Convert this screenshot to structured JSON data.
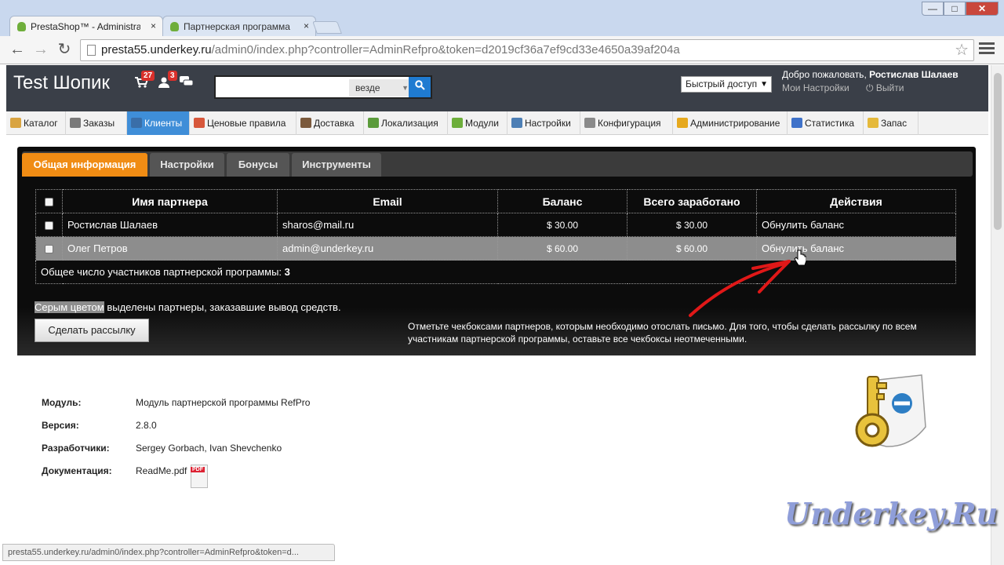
{
  "browser": {
    "tabs": [
      {
        "title": "PrestaShop™ - Administra",
        "close": "×"
      },
      {
        "title": "Партнерская программа",
        "close": "×"
      }
    ],
    "url_host": "presta55.underkey.ru",
    "url_path": "/admin0/index.php?controller=AdminRefpro&token=d2019cf36a7ef9cd33e4650a39af204a",
    "status_url": "presta55.underkey.ru/admin0/index.php?controller=AdminRefpro&token=d...",
    "window_controls": {
      "minimize": "—",
      "maximize": "□",
      "close": "✕"
    },
    "nav": {
      "back": "←",
      "forward": "→",
      "reload": "↻"
    },
    "star": "☆"
  },
  "header": {
    "shop_name": "Test Шопик",
    "cart_badge": "27",
    "customers_badge": "3",
    "search_placeholder": "",
    "search_scope": "везде",
    "quick_access": "Быстрый доступ",
    "welcome_prefix": "Добро пожаловать, ",
    "user_name": "Ростислав Шалаев",
    "my_settings": "Мои Настройки",
    "logout": "Выйти",
    "icons": {
      "cart": "cart-icon",
      "customers": "customers-icon",
      "messages": "messages-icon",
      "search": "search-icon",
      "logout": "power-icon"
    }
  },
  "menu": {
    "items": [
      {
        "label": "Каталог",
        "color": "#d9a441"
      },
      {
        "label": "Заказы",
        "color": "#7a7a7a"
      },
      {
        "label": "Клиенты",
        "color": "#3a6ea8"
      },
      {
        "label": "Ценовые правила",
        "color": "#d7573b"
      },
      {
        "label": "Доставка",
        "color": "#7b5a3d"
      },
      {
        "label": "Локализация",
        "color": "#5b9b3b"
      },
      {
        "label": "Модули",
        "color": "#6dae3b"
      },
      {
        "label": "Настройки",
        "color": "#4d7fb5"
      },
      {
        "label": "Конфигурация",
        "color": "#8a8a8a"
      },
      {
        "label": "Администрирование",
        "color": "#e6a91e"
      },
      {
        "label": "Статистика",
        "color": "#3f72c9"
      },
      {
        "label": "Запас",
        "color": "#e5b93b"
      }
    ],
    "active_index": 2,
    "active_color": "#3f8ed8"
  },
  "panel": {
    "tabs": [
      "Общая информация",
      "Настройки",
      "Бонусы",
      "Инструменты"
    ],
    "active_tab": 0,
    "accent": "#f08c14",
    "columns": [
      "Имя партнера",
      "Email",
      "Баланс",
      "Всего заработано",
      "Действия"
    ],
    "rows": [
      {
        "name": "Ростислав Шалаев",
        "email": "sharos@mail.ru",
        "balance": "$ 30.00",
        "earned": "$ 30.00",
        "action": "Обнулить баланс"
      },
      {
        "name": "Олег Петров",
        "email": "admin@underkey.ru",
        "balance": "$ 60.00",
        "earned": "$ 60.00",
        "action": "Обнулить баланс"
      }
    ],
    "total_label": "Общее число участников партнерской программы:",
    "total_value": "3",
    "legend_highlight": "Серым цветом",
    "legend_rest": " выделены партнеры, заказавшие вывод средств.",
    "mail_button": "Сделать рассылку",
    "hint": "Отметьте чекбоксами партнеров, которым необходимо отослать письмо. Для того, чтобы сделать рассылку по всем участникам партнерской программы, оставьте все чекбоксы неотмеченными."
  },
  "module_info": {
    "module_label": "Модуль:",
    "module_value": "Модуль партнерской программы RefPro",
    "version_label": "Версия:",
    "version_value": "2.8.0",
    "dev_label": "Разработчики:",
    "dev_value": "Sergey Gorbach, Ivan Shevchenko",
    "doc_label": "Документация:",
    "doc_value": "ReadMe.pdf"
  },
  "watermark": "Underkey.Ru"
}
